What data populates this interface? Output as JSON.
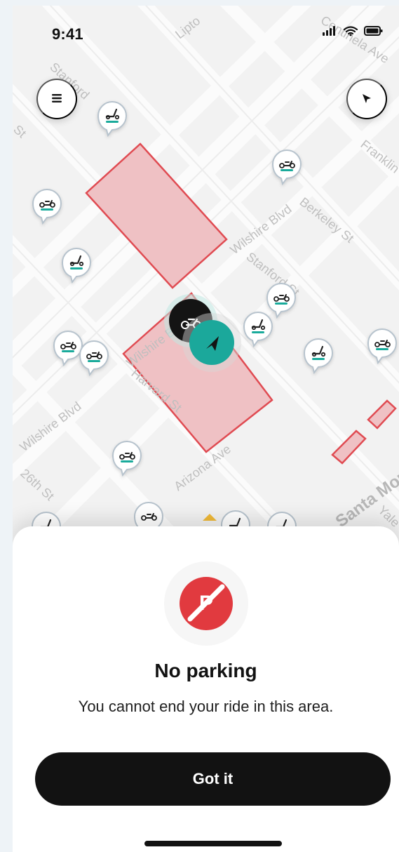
{
  "status": {
    "time": "9:41",
    "icons": [
      "cellular-signal-icon",
      "wifi-icon",
      "battery-icon"
    ]
  },
  "map": {
    "streets": [
      "Lipto",
      "Stanford",
      "St",
      "Franklin",
      "Wilshire Blvd",
      "Berkeley St",
      "Stanford St",
      "Wilshire Blvd",
      "Harvard St",
      "Wilshire Blvd",
      "26th St",
      "Arizona Ave",
      "Centinela Ave",
      "Santa Monica Blvd",
      "Yale"
    ],
    "accent": "#19aa9b",
    "zone_fill": "#efc1c4",
    "zone_stroke": "#e04b52"
  },
  "buttons": {
    "menu": "hamburger-menu-icon",
    "locate": "location-arrow-icon"
  },
  "modal": {
    "badge_icon": "no-parking-icon",
    "badge_letter": "P",
    "title": "No parking",
    "description": "You cannot end your ride in this area.",
    "cta": "Got it"
  }
}
